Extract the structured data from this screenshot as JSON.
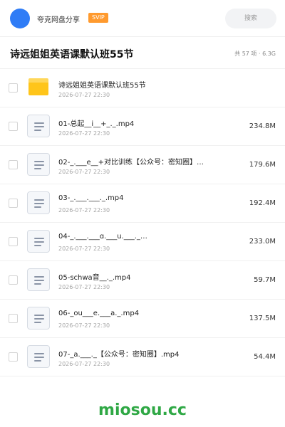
{
  "header": {
    "username": "夸克网盘分享",
    "vip_badge": "SVIP",
    "search_placeholder": "搜索"
  },
  "title_bar": {
    "title": "诗远姐姐英语课默认班55节",
    "meta": "共 57 项 · 6.3G"
  },
  "files": [
    {
      "type": "folder",
      "name": "诗远姐姐英语课默认班55节",
      "date": "2026-07-27 22:30",
      "size": ""
    },
    {
      "type": "video",
      "name": "01-总起__i__+_._.mp4",
      "date": "2026-07-27 22:30",
      "size": "234.8M"
    },
    {
      "type": "video",
      "name": "02-_.___e__+对比训练【公众号：密知圈】…",
      "date": "2026-07-27 22:30",
      "size": "179.6M"
    },
    {
      "type": "video",
      "name": "03-_.___.___._.mp4",
      "date": "2026-07-27 22:30",
      "size": "192.4M"
    },
    {
      "type": "video",
      "name": "04-_.___.___ɑ.___u.___._…",
      "date": "2026-07-27 22:30",
      "size": "233.0M"
    },
    {
      "type": "video",
      "name": "05-schwa音__._.mp4",
      "date": "2026-07-27 22:30",
      "size": "59.7M"
    },
    {
      "type": "video",
      "name": "06-_ou___e.___a._.mp4",
      "date": "2026-07-27 22:30",
      "size": "137.5M"
    },
    {
      "type": "video",
      "name": "07-_a.___._【公众号：密知圈】.mp4",
      "date": "2026-07-27 22:30",
      "size": "54.4M"
    }
  ],
  "icons": {
    "folder": "folder-icon",
    "video": "video-file-icon"
  },
  "colors": {
    "avatar": "#2f7cf6",
    "vip_badge": "#ff9a2e",
    "folder": "#ffc51a",
    "watermark": "#2fa845"
  },
  "watermark": "miosou.cc"
}
